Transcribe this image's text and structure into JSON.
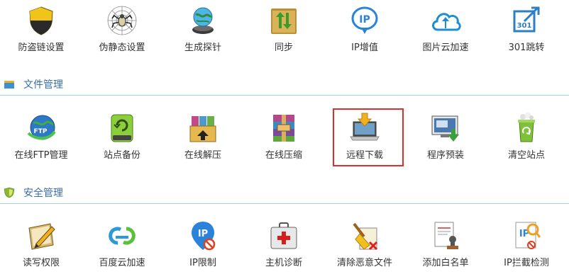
{
  "rows": [
    {
      "items": [
        {
          "label": "防盗链设置",
          "icon": "shield-icon"
        },
        {
          "label": "伪静态设置",
          "icon": "spider-icon"
        },
        {
          "label": "生成探针",
          "icon": "globe-probe-icon"
        },
        {
          "label": "同步",
          "icon": "sync-folder-icon"
        },
        {
          "label": "IP增值",
          "icon": "ip-pin-icon"
        },
        {
          "label": "图片云加速",
          "icon": "cloud-icon"
        },
        {
          "label": "301跳转",
          "icon": "redirect-301-icon"
        }
      ]
    },
    {
      "items": [
        {
          "label": "在线FTP管理",
          "icon": "ftp-globe-icon"
        },
        {
          "label": "站点备份",
          "icon": "backup-drive-icon"
        },
        {
          "label": "在线解压",
          "icon": "archive-extract-icon"
        },
        {
          "label": "在线压缩",
          "icon": "archive-compress-icon"
        },
        {
          "label": "远程下载",
          "icon": "laptop-download-icon"
        },
        {
          "label": "程序预装",
          "icon": "monitor-install-icon"
        },
        {
          "label": "清空站点",
          "icon": "recycle-bin-icon"
        }
      ]
    },
    {
      "items": [
        {
          "label": "读写权限",
          "icon": "notebook-pen-icon"
        },
        {
          "label": "百度云加速",
          "icon": "cloud-sync-icon"
        },
        {
          "label": "IP限制",
          "icon": "ip-block-icon"
        },
        {
          "label": "主机诊断",
          "icon": "first-aid-icon"
        },
        {
          "label": "清除恶意文件",
          "icon": "broom-clean-icon"
        },
        {
          "label": "添加白名单",
          "icon": "certificate-stamp-icon"
        },
        {
          "label": "IP拦截检测",
          "icon": "ip-search-icon"
        }
      ]
    }
  ],
  "sections": [
    {
      "title": "文件管理",
      "icon": "folder-icon"
    },
    {
      "title": "安全管理",
      "icon": "shield-badge-icon"
    }
  ],
  "highlighted_item": "远程下载",
  "colors": {
    "section_title": "#3a6ea5",
    "divider": "#9fd3d8",
    "highlight_border": "#d9302c",
    "text": "#333333"
  }
}
